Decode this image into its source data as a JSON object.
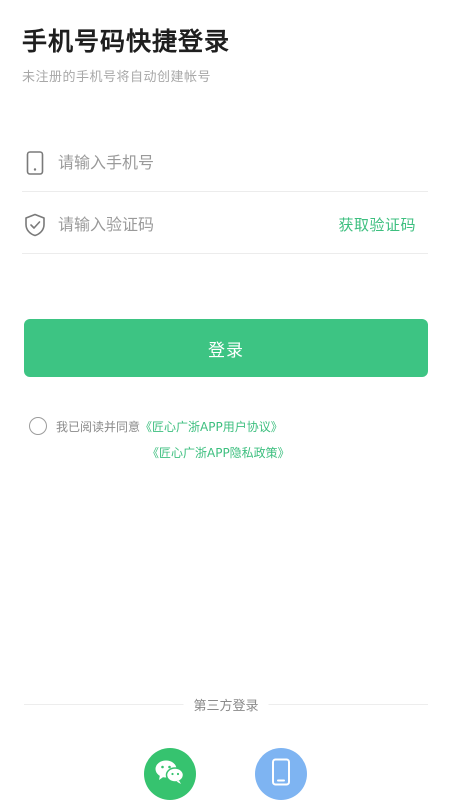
{
  "header": {
    "title": "手机号码快捷登录",
    "subtitle": "未注册的手机号将自动创建帐号"
  },
  "form": {
    "phone_placeholder": "请输入手机号",
    "code_placeholder": "请输入验证码",
    "get_code_label": "获取验证码",
    "login_label": "登录"
  },
  "agreement": {
    "prefix": "我已阅读并同意",
    "user_agreement": "《匠心广浙APP用户协议》",
    "privacy_policy": "《匠心广浙APP隐私政策》"
  },
  "third_party": {
    "label": "第三方登录",
    "options": [
      "wechat-icon",
      "phone-icon"
    ]
  },
  "colors": {
    "accent": "#3dc483",
    "link": "#3dbf7f",
    "wechat": "#36c36f",
    "phone_login": "#7eb4f2"
  }
}
